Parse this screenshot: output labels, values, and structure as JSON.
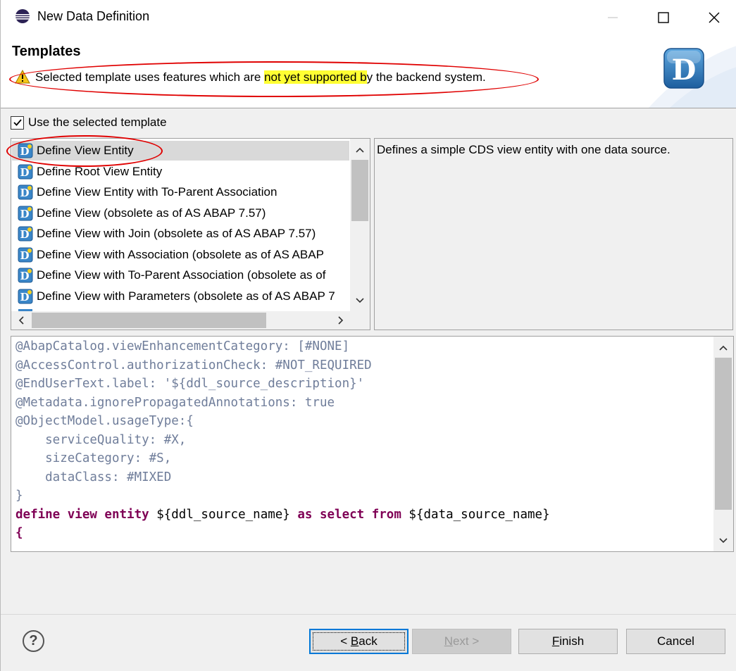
{
  "window": {
    "title": "New Data Definition"
  },
  "banner": {
    "title": "Templates",
    "warning_prefix": "Selected template uses features which are ",
    "warning_highlight": "not yet supported b",
    "warning_suffix": "y the backend system.",
    "logo_letter": "D"
  },
  "use_template": {
    "label": "Use the selected template",
    "checked": true
  },
  "templates": [
    {
      "label": "Define View Entity",
      "selected": true
    },
    {
      "label": "Define Root View Entity",
      "selected": false
    },
    {
      "label": "Define View Entity with To-Parent Association",
      "selected": false
    },
    {
      "label": "Define View (obsolete as of AS ABAP 7.57)",
      "selected": false
    },
    {
      "label": "Define View with Join (obsolete as of AS ABAP 7.57)",
      "selected": false
    },
    {
      "label": "Define View with Association (obsolete as of AS ABAP",
      "selected": false
    },
    {
      "label": "Define View with To-Parent Association (obsolete as of",
      "selected": false
    },
    {
      "label": "Define View with Parameters (obsolete as of AS ABAP 7",
      "selected": false
    }
  ],
  "description": "Defines a simple CDS view entity with one data source.",
  "code": [
    {
      "parts": [
        {
          "t": "@AbapCatalog.viewEnhancementCategory: [#NONE]",
          "c": "anno"
        }
      ]
    },
    {
      "parts": [
        {
          "t": "@AccessControl.authorizationCheck: #NOT_REQUIRED",
          "c": "anno"
        }
      ]
    },
    {
      "parts": [
        {
          "t": "@EndUserText.label: '${ddl_source_description}'",
          "c": "anno"
        }
      ]
    },
    {
      "parts": [
        {
          "t": "@Metadata.ignorePropagatedAnnotations: true",
          "c": "anno"
        }
      ]
    },
    {
      "parts": [
        {
          "t": "@ObjectModel.usageType:{",
          "c": "anno"
        }
      ]
    },
    {
      "parts": [
        {
          "t": "    serviceQuality: #X,",
          "c": "anno"
        }
      ]
    },
    {
      "parts": [
        {
          "t": "    sizeCategory: #S,",
          "c": "anno"
        }
      ]
    },
    {
      "parts": [
        {
          "t": "    dataClass: #MIXED",
          "c": "anno"
        }
      ]
    },
    {
      "parts": [
        {
          "t": "}",
          "c": "anno"
        }
      ]
    },
    {
      "parts": [
        {
          "t": "define view entity ",
          "c": "kw"
        },
        {
          "t": "${ddl_source_name} ",
          "c": "plain"
        },
        {
          "t": "as select from ",
          "c": "kw"
        },
        {
          "t": "${data_source_name}",
          "c": "plain"
        }
      ]
    },
    {
      "parts": [
        {
          "t": "{",
          "c": "kw"
        }
      ]
    }
  ],
  "buttons": {
    "help": "?",
    "back_mnemonic": "B",
    "back_label_prefix": "< ",
    "back_label_rest": "ack",
    "next_mnemonic": "N",
    "next_label_rest": "ext >",
    "finish_mnemonic": "F",
    "finish_label_rest": "inish",
    "cancel": "Cancel"
  },
  "colors": {
    "highlight": "#ffff33",
    "annotation_red": "#e00000",
    "keyword": "#7f0055",
    "annotation_text": "#6f7d9a"
  }
}
